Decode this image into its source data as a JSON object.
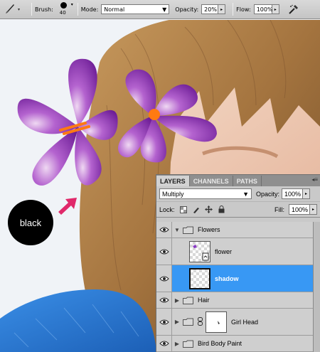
{
  "options_bar": {
    "brush_label": "Brush:",
    "brush_size": "40",
    "mode_label": "Mode:",
    "mode_value": "Normal",
    "opacity_label": "Opacity:",
    "opacity_value": "20%",
    "flow_label": "Flow:",
    "flow_value": "100%"
  },
  "canvas": {
    "swatch_label": "black",
    "arrow_color": "#e0286a"
  },
  "layers_panel": {
    "tabs": [
      "LAYERS",
      "CHANNELS",
      "PATHS"
    ],
    "blend_mode": "Multiply",
    "opacity_label": "Opacity:",
    "opacity_value": "100%",
    "lock_label": "Lock:",
    "fill_label": "Fill:",
    "fill_value": "100%",
    "layers": [
      {
        "name": "Flowers",
        "type": "group",
        "expanded": true
      },
      {
        "name": "flower",
        "type": "layer"
      },
      {
        "name": "shadow",
        "type": "layer",
        "selected": true
      },
      {
        "name": "Hair",
        "type": "group"
      },
      {
        "name": "Girl Head",
        "type": "group-with-mask"
      },
      {
        "name": "Bird Body Paint",
        "type": "group"
      }
    ],
    "selected_color": "#3898f4"
  }
}
